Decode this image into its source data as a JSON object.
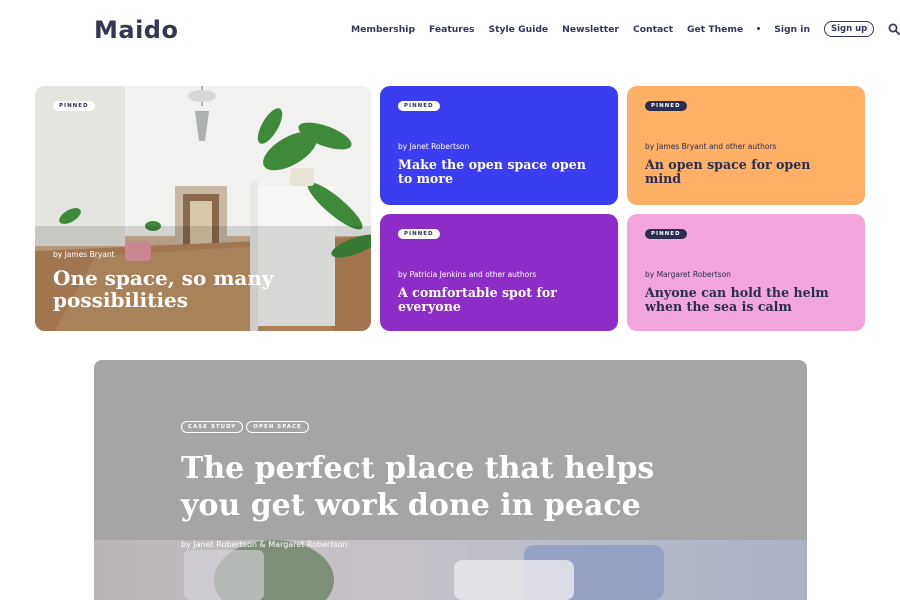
{
  "header": {
    "logo": "Maido",
    "nav": [
      "Membership",
      "Features",
      "Style Guide",
      "Newsletter",
      "Contact",
      "Get Theme"
    ],
    "sign_in": "Sign in",
    "sign_up": "Sign up",
    "icons": {
      "search": "search-icon",
      "separator": "dot"
    }
  },
  "cards": [
    {
      "badge": "PINNED",
      "byline": "by James Bryant",
      "title": "One space, so many possibilities",
      "color": "photo"
    },
    {
      "badge": "PINNED",
      "byline": "by Janet Robertson",
      "title": "Make the open space open to more",
      "color": "#3b3ef0"
    },
    {
      "badge": "PINNED",
      "byline": "by James Bryant and other authors",
      "title": "An open space for open mind",
      "color": "#ffb067"
    },
    {
      "badge": "PINNED",
      "byline": "by Patricia Jenkins and other authors",
      "title": "A comfortable spot for everyone",
      "color": "#8e2cc8"
    },
    {
      "badge": "PINNED",
      "byline": "by Margaret Robertson",
      "title": "Anyone can hold the helm when the sea is calm",
      "color": "#f3a6dc"
    }
  ],
  "feature": {
    "tags": [
      "CASE STUDY",
      "OPEN SPACE"
    ],
    "title": "The perfect place that helps you get work done in peace",
    "byline": "by Janet Robertson & Margaret Robertson"
  }
}
